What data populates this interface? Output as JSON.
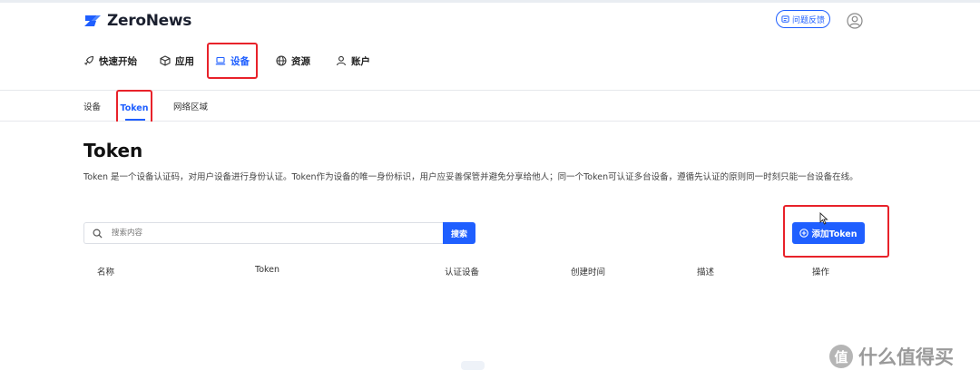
{
  "brand": {
    "name": "ZeroNews",
    "accent": "#1f5fff",
    "logo_color": "#1f5fff"
  },
  "header": {
    "feedback_label": "问题反馈",
    "feedback_icon": "feedback-icon",
    "user_icon": "user-circle-icon"
  },
  "main_nav": {
    "items": [
      {
        "label": "快速开始",
        "icon": "rocket-icon",
        "active": false
      },
      {
        "label": "应用",
        "icon": "cube-icon",
        "active": false
      },
      {
        "label": "设备",
        "icon": "laptop-icon",
        "active": true
      },
      {
        "label": "资源",
        "icon": "globe-icon",
        "active": false
      },
      {
        "label": "账户",
        "icon": "person-icon",
        "active": false
      }
    ]
  },
  "sub_nav": {
    "items": [
      {
        "label": "设备",
        "active": false
      },
      {
        "label": "Token",
        "active": true
      },
      {
        "label": "网络区域",
        "active": false
      }
    ]
  },
  "page": {
    "title": "Token",
    "description": "Token 是一个设备认证码，对用户设备进行身份认证。Token作为设备的唯一身份标识，用户应妥善保管并避免分享给他人；同一个Token可认证多台设备，遵循先认证的原则同一时刻只能一台设备在线。"
  },
  "search": {
    "placeholder": "搜索内容",
    "value": "",
    "button_label": "搜索"
  },
  "add_button": {
    "label": "添加Token",
    "icon": "plus-circle-icon"
  },
  "table": {
    "columns": [
      "名称",
      "Token",
      "认证设备",
      "创建时间",
      "描述",
      "操作"
    ],
    "rows": []
  },
  "watermark": {
    "text": "什么值得买",
    "icon_char": "值"
  },
  "annotations": {
    "highlight_color": "#e8222a"
  }
}
